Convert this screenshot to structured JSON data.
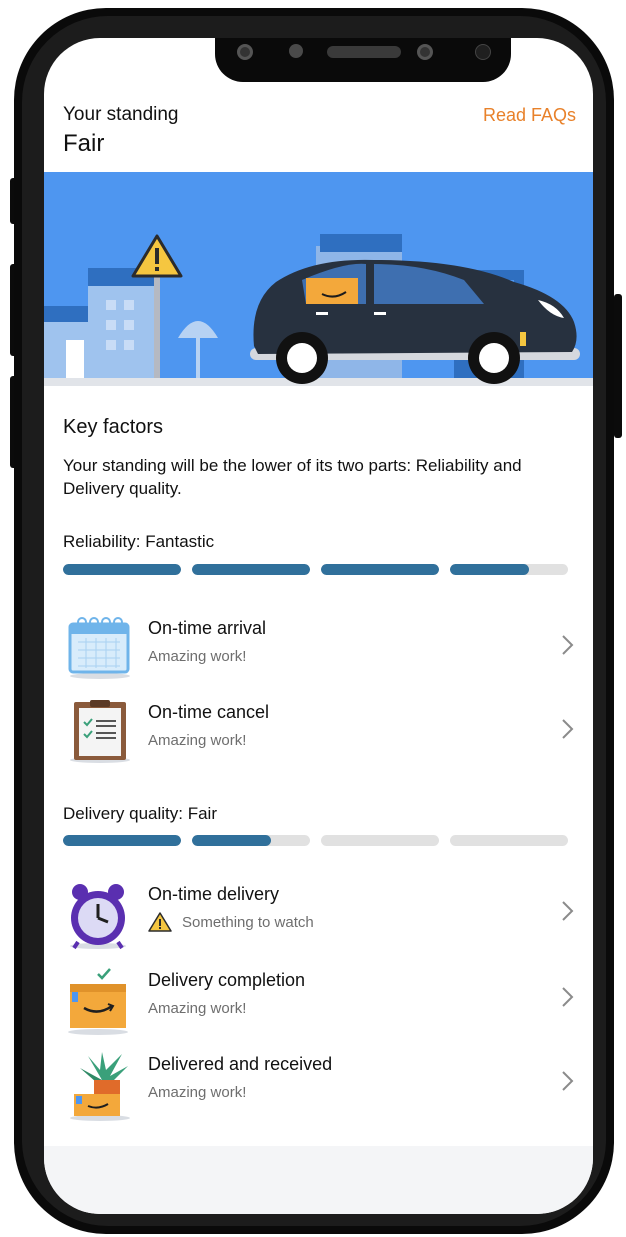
{
  "header": {
    "title": "Your standing",
    "value": "Fair",
    "faq_link": "Read FAQs"
  },
  "key_factors": {
    "title": "Key factors",
    "description": "Your standing will be the lower of its two parts: Reliability and Delivery quality."
  },
  "reliability": {
    "label": "Reliability: Fantastic",
    "progress_segments": [
      1,
      1,
      1,
      0.67
    ],
    "items": [
      {
        "title": "On-time arrival",
        "status": "Amazing work!",
        "icon": "calendar-icon"
      },
      {
        "title": "On-time cancel",
        "status": "Amazing work!",
        "icon": "clipboard-icon"
      }
    ]
  },
  "delivery_quality": {
    "label": "Delivery quality: Fair",
    "progress_segments": [
      1,
      0.67,
      0,
      0
    ],
    "items": [
      {
        "title": "On-time delivery",
        "status": "Something to watch",
        "icon": "alarm-clock-icon",
        "warning": true
      },
      {
        "title": "Delivery completion",
        "status": "Amazing work!",
        "icon": "package-check-icon"
      },
      {
        "title": "Delivered and received",
        "status": "Amazing work!",
        "icon": "package-plant-icon"
      }
    ]
  },
  "colors": {
    "accent_orange": "#e8812a",
    "progress_fill": "#30709b",
    "progress_track": "#e1e1e1",
    "banner_sky": "#4e96f0"
  }
}
